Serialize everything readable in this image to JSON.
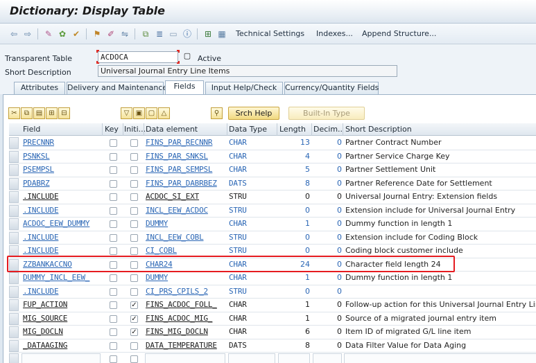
{
  "window": {
    "title": "Dictionary: Display Table"
  },
  "toolbar": {
    "buttons": [
      "Technical Settings",
      "Indexes...",
      "Append Structure..."
    ]
  },
  "header": {
    "table_type_label": "Transparent Table",
    "table_name": "ACDOCA",
    "status": "Active",
    "short_desc_label": "Short Description",
    "short_desc": "Universal Journal Entry Line Items"
  },
  "tabs": [
    "Attributes",
    "Delivery and Maintenance",
    "Fields",
    "Input Help/Check",
    "Currency/Quantity Fields"
  ],
  "active_tab": "Fields",
  "table_toolbar": {
    "srch_help": "Srch Help",
    "built_in_type": "Built-In Type"
  },
  "columns": {
    "field": "Field",
    "key": "Key",
    "initial": "Initi...",
    "data_element": "Data element",
    "data_type": "Data Type",
    "length": "Length",
    "decimals": "Decim...",
    "short_desc": "Short Description"
  },
  "rows": [
    {
      "field": "PRECNNR",
      "key": false,
      "initial": false,
      "data_element": "FINS_PAR_RECNNR",
      "data_type": "CHAR",
      "length": "13",
      "decimals": "0",
      "desc": "Partner Contract Number",
      "style": "link"
    },
    {
      "field": "PSNKSL",
      "key": false,
      "initial": false,
      "data_element": "FINS_PAR_SNKSL",
      "data_type": "CHAR",
      "length": "4",
      "decimals": "0",
      "desc": "Partner Service Charge Key",
      "style": "link"
    },
    {
      "field": "PSEMPSL",
      "key": false,
      "initial": false,
      "data_element": "FINS_PAR_SEMPSL",
      "data_type": "CHAR",
      "length": "5",
      "decimals": "0",
      "desc": "Partner Settlement Unit",
      "style": "link"
    },
    {
      "field": "PDABRZ",
      "key": false,
      "initial": false,
      "data_element": "FINS_PAR_DABRBEZ",
      "data_type": "DATS",
      "length": "8",
      "decimals": "0",
      "desc": "Partner Reference Date for Settlement",
      "style": "link"
    },
    {
      "field": ".INCLUDE",
      "key": false,
      "initial": false,
      "data_element": "ACDOC_SI_EXT",
      "data_type": "STRU",
      "length": "0",
      "decimals": "0",
      "desc": "Universal Journal Entry: Extension fields",
      "style": "dark"
    },
    {
      "field": ".INCLUDE",
      "key": false,
      "initial": false,
      "data_element": "INCL_EEW_ACDOC",
      "data_type": "STRU",
      "length": "0",
      "decimals": "0",
      "desc": "Extension include for Universal Journal Entry",
      "style": "link"
    },
    {
      "field": "ACDOC_EEW_DUMMY",
      "key": false,
      "initial": false,
      "data_element": "DUMMY",
      "data_type": "CHAR",
      "length": "1",
      "decimals": "0",
      "desc": "Dummy function in length 1",
      "style": "link"
    },
    {
      "field": ".INCLUDE",
      "key": false,
      "initial": false,
      "data_element": "INCL_EEW_COBL",
      "data_type": "STRU",
      "length": "0",
      "decimals": "0",
      "desc": "Extension include for Coding Block",
      "style": "link"
    },
    {
      "field": ".INCLUDE",
      "key": false,
      "initial": false,
      "data_element": "CI_COBL",
      "data_type": "STRU",
      "length": "0",
      "decimals": "0",
      "desc": "Coding block customer include",
      "style": "link"
    },
    {
      "field": "ZZBANKACCNO",
      "key": false,
      "initial": false,
      "data_element": "CHAR24",
      "data_type": "CHAR",
      "length": "24",
      "decimals": "0",
      "desc": "Character field length 24",
      "style": "link"
    },
    {
      "field": "DUMMY_INCL_EEW_",
      "key": false,
      "initial": false,
      "data_element": "DUMMY",
      "data_type": "CHAR",
      "length": "1",
      "decimals": "0",
      "desc": "Dummy function in length 1",
      "style": "link"
    },
    {
      "field": ".INCLUDE",
      "key": false,
      "initial": false,
      "data_element": "CI_PRS_CPILS_2",
      "data_type": "STRU",
      "length": "0",
      "decimals": "0",
      "desc": "",
      "style": "link"
    },
    {
      "field": "FUP_ACTION",
      "key": false,
      "initial": true,
      "data_element": "FINS_ACDOC_FOLL_",
      "data_type": "CHAR",
      "length": "1",
      "decimals": "0",
      "desc": "Follow-up action for this Universal Journal Entry Line Item",
      "style": "dark"
    },
    {
      "field": "MIG_SOURCE",
      "key": false,
      "initial": true,
      "data_element": "FINS_ACDOC_MIG_",
      "data_type": "CHAR",
      "length": "1",
      "decimals": "0",
      "desc": "Source of a migrated journal entry item",
      "style": "dark"
    },
    {
      "field": "MIG_DOCLN",
      "key": false,
      "initial": true,
      "data_element": "FINS_MIG_DOCLN",
      "data_type": "CHAR",
      "length": "6",
      "decimals": "0",
      "desc": "Item ID of migrated G/L line item",
      "style": "dark"
    },
    {
      "field": "_DATAAGING",
      "key": false,
      "initial": false,
      "data_element": "DATA_TEMPERATURE",
      "data_type": "DATS",
      "length": "8",
      "decimals": "0",
      "desc": "Data Filter Value for Data Aging",
      "style": "dark"
    },
    {
      "field": "",
      "key": false,
      "initial": false,
      "data_element": "",
      "data_type": "",
      "length": "",
      "decimals": "",
      "desc": "",
      "style": "empty"
    }
  ]
}
